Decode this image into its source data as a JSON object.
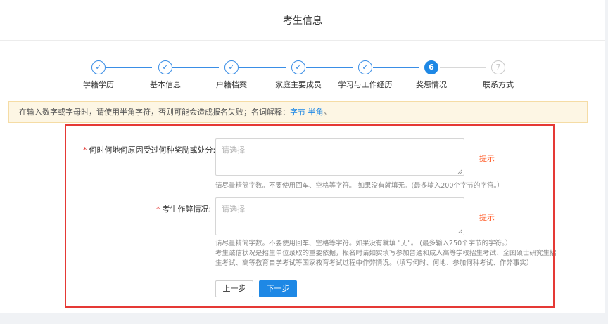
{
  "header": {
    "title": "考生信息"
  },
  "steps": [
    {
      "label": "学籍学历",
      "icon": "check-icon",
      "mark": "✓",
      "state": "done"
    },
    {
      "label": "基本信息",
      "icon": "check-icon",
      "mark": "✓",
      "state": "done"
    },
    {
      "label": "户籍档案",
      "icon": "check-icon",
      "mark": "✓",
      "state": "done"
    },
    {
      "label": "家庭主要成员",
      "icon": "check-icon",
      "mark": "✓",
      "state": "done"
    },
    {
      "label": "学习与工作经历",
      "icon": "check-icon",
      "mark": "✓",
      "state": "done"
    },
    {
      "label": "奖惩情况",
      "icon": "",
      "mark": "6",
      "state": "active"
    },
    {
      "label": "联系方式",
      "icon": "",
      "mark": "7",
      "state": "pending"
    }
  ],
  "notice": {
    "text": "在输入数字或字母时，请使用半角字符，否则可能会造成报名失败；名词解释：",
    "link1": "字节",
    "link2": "半角",
    "suffix": "。"
  },
  "form": {
    "required_mark": "*",
    "reward": {
      "label": "何时何地何原因受过何种奖励或处分:",
      "placeholder": "请选择",
      "hint": "提示",
      "help": "请尽量精简字数。不要使用回车、空格等字符。 如果没有就填无。(最多输入200个字节的字符。）"
    },
    "cheating": {
      "label": "考生作弊情况:",
      "placeholder": "请选择",
      "hint": "提示",
      "help_lines": [
        "请尽量精简字数。不要使用回车、空格等字符。如果没有就填 \"无\"。 (最多输入250个字节的字符。）",
        "考生诚信状况是招生单位录取的重要依据，报名时请如实填写参加普通和成人高等学校招生考试、全国硕士研究生招",
        "生考试、高等教育自学考试等国家教育考试过程中作弊情况。（填写何时、何地、参加何种考试、作弊事实）"
      ]
    }
  },
  "buttons": {
    "prev": "上一步",
    "next": "下一步"
  },
  "colors": {
    "primary": "#1e88e5",
    "required": "#e53935",
    "hint": "#ff5722",
    "highlight_box": "#e53935",
    "notice_bg": "#fdf6e4"
  }
}
